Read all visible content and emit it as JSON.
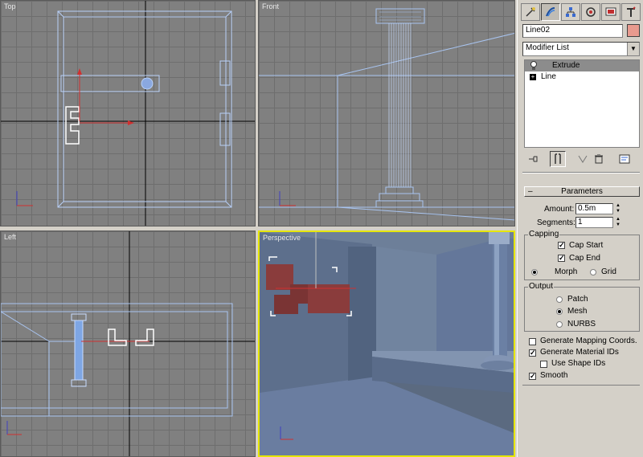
{
  "viewports": {
    "top": {
      "label": "Top"
    },
    "front": {
      "label": "Front"
    },
    "left": {
      "label": "Left"
    },
    "perspective": {
      "label": "Perspective"
    }
  },
  "command_panel": {
    "tabs": [
      {
        "icon": "create-icon",
        "active": false
      },
      {
        "icon": "modify-icon",
        "active": true
      },
      {
        "icon": "hierarchy-icon",
        "active": false
      },
      {
        "icon": "motion-icon",
        "active": false
      },
      {
        "icon": "display-icon",
        "active": false
      },
      {
        "icon": "utilities-icon",
        "active": false
      }
    ],
    "object_name": "Line02",
    "object_color": "#e89a8e",
    "modifier_list": "Modifier List",
    "stack": [
      {
        "label": "Extrude",
        "selected": true,
        "icon": "bulb-icon"
      },
      {
        "label": "Line",
        "selected": false,
        "icon": "plus-icon"
      }
    ],
    "parameters": {
      "title": "Parameters",
      "amount_label": "Amount:",
      "amount_value": "0.5m",
      "segments_label": "Segments:",
      "segments_value": "1",
      "capping": {
        "title": "Capping",
        "cap_start": "Cap Start",
        "cap_end": "Cap End",
        "morph": "Morph",
        "grid": "Grid"
      },
      "output": {
        "title": "Output",
        "patch": "Patch",
        "mesh": "Mesh",
        "nurbs": "NURBS"
      },
      "gen_mapping": "Generate Mapping Coords.",
      "gen_material": "Generate Material IDs",
      "use_shape": "Use Shape IDs",
      "smooth": "Smooth"
    },
    "state": {
      "cap_start": true,
      "cap_end": true,
      "capping_mode": "Morph",
      "output_mode": "Mesh",
      "gen_mapping": false,
      "gen_material": true,
      "use_shape": false,
      "smooth": true
    }
  },
  "colors": {
    "viewport_bg": "#808080",
    "wire": "#a8c4f0",
    "active_border": "#e6e600",
    "selection": "#ffffff",
    "x_axis": "#d03030",
    "y_axis": "#4040c0"
  }
}
